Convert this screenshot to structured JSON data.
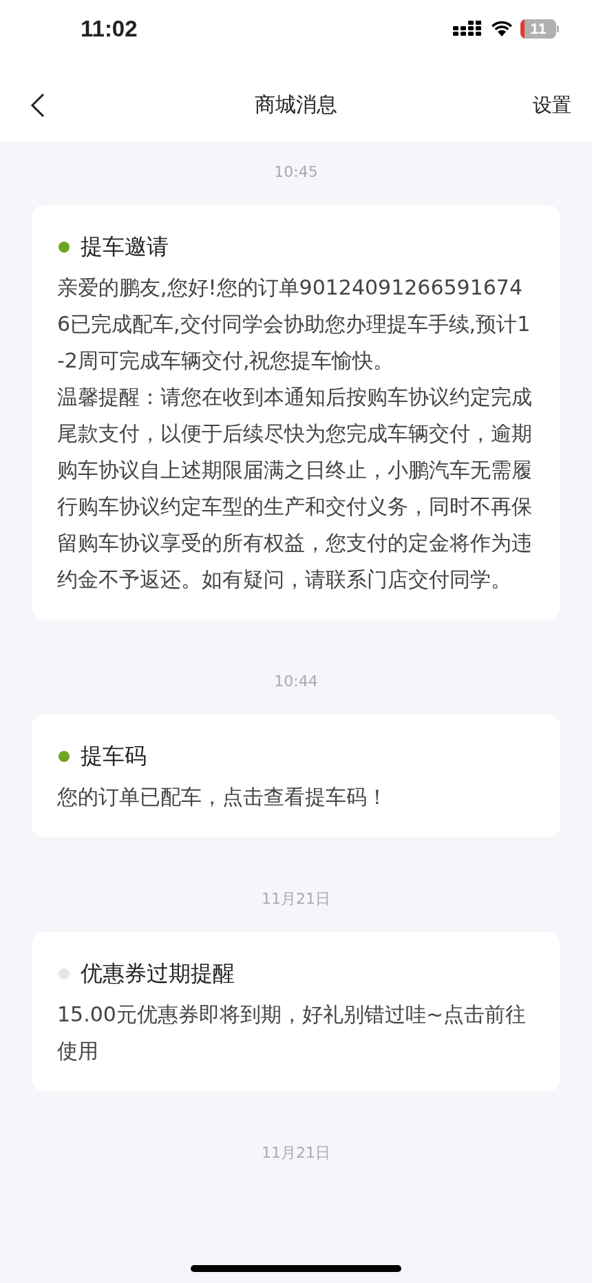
{
  "status_bar": {
    "time": "11:02",
    "battery": "11"
  },
  "nav": {
    "title": "商城消息",
    "action": "设置"
  },
  "messages": [
    {
      "time": "10:45",
      "title": "提车邀请",
      "unread": true,
      "body": [
        "亲爱的鹏友,您好!您的订单901240912665916746已完成配车,交付同学会协助您办理提车手续,预计1-2周可完成车辆交付,祝您提车愉快。",
        "温馨提醒：请您在收到本通知后按购车协议约定完成尾款支付，以便于后续尽快为您完成车辆交付，逾期购车协议自上述期限届满之日终止，小鹏汽车无需履行购车协议约定车型的生产和交付义务，同时不再保留购车协议享受的所有权益，您支付的定金将作为违约金不予返还。如有疑问，请联系门店交付同学。"
      ]
    },
    {
      "time": "10:44",
      "title": "提车码",
      "unread": true,
      "body": [
        "您的订单已配车，点击查看提车码！"
      ]
    },
    {
      "time": "11月21日",
      "title": "优惠券过期提醒",
      "unread": false,
      "body": [
        "15.00元优惠券即将到期，好礼别错过哇~点击前往使用"
      ]
    }
  ],
  "trailing_time": "11月21日"
}
